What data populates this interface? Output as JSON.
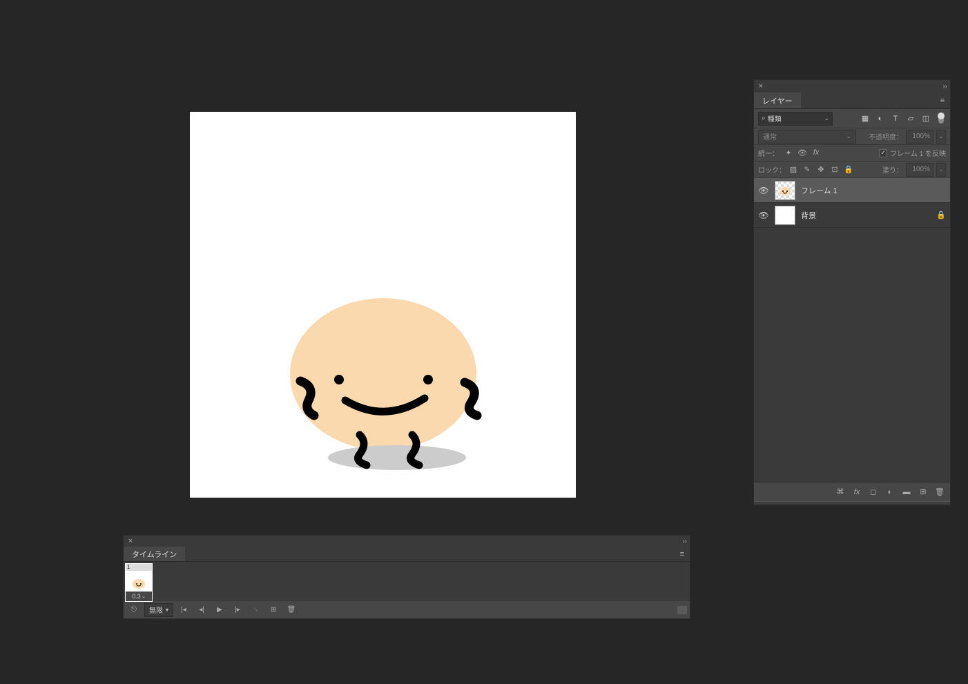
{
  "layers_panel": {
    "title": "レイヤー",
    "filter_label": "種類",
    "blend_mode": "通常",
    "opacity_label": "不透明度：",
    "opacity_value": "100%",
    "unify_label": "統一：",
    "propagate_label": "フレーム 1 を反映",
    "lock_label": "ロック：",
    "fill_label": "塗り：",
    "fill_value": "100%",
    "layers": [
      {
        "name": "フレーム 1",
        "visible": true,
        "selected": true,
        "locked": false,
        "thumb": "frame"
      },
      {
        "name": "背景",
        "visible": true,
        "selected": false,
        "locked": true,
        "thumb": "bg"
      }
    ]
  },
  "timeline_panel": {
    "title": "タイムライン",
    "loop_label": "無限",
    "frames": [
      {
        "num": "1",
        "delay": "0.3"
      }
    ]
  }
}
